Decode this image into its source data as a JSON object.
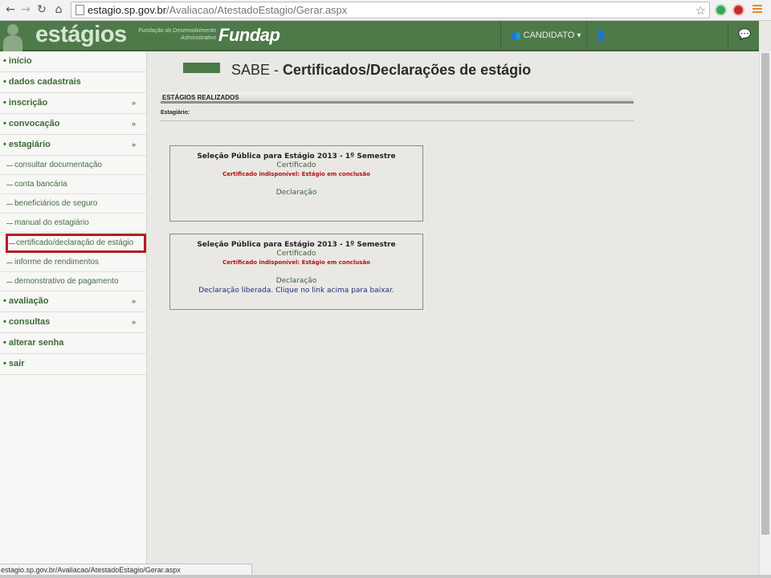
{
  "browser": {
    "url_host": "estagio.sp.gov.br",
    "url_path": "/Avaliacao/AtestadoEstagio/Gerar.aspx",
    "status_url": "estagio.sp.gov.br/Avaliacao/AtestadoEstagio/Gerar.aspx"
  },
  "header": {
    "logo": "estágios",
    "fund_small_1": "Fundação do Desenvolvimento",
    "fund_small_2": "Administrativo",
    "fund_brand": "Fundap",
    "candidate_label": "CANDIDATO",
    "accent": "#4e7a4a"
  },
  "sidebar": {
    "items": [
      {
        "label": "início"
      },
      {
        "label": "dados cadastrais"
      },
      {
        "label": "inscrição",
        "chevron": "»"
      },
      {
        "label": "convocação",
        "chevron": "»"
      },
      {
        "label": "estagiário",
        "chevron": "»"
      },
      {
        "label": "avaliação",
        "chevron": "»"
      },
      {
        "label": "consultas",
        "chevron": "»"
      },
      {
        "label": "alterar senha"
      },
      {
        "label": "sair"
      }
    ],
    "sub_items": [
      {
        "label": "consultar documentação"
      },
      {
        "label": "conta bancária"
      },
      {
        "label": "beneficiários de seguro"
      },
      {
        "label": "manual do estagiário"
      },
      {
        "label": "certificado/declaração de estágio"
      },
      {
        "label": "informe de rendimentos"
      },
      {
        "label": "demonstrativo de pagamento"
      }
    ]
  },
  "main": {
    "title_prefix": "SABE - ",
    "title": "Certificados/Declarações de estágio",
    "section_header": "ESTÁGIOS REALIZADOS",
    "estagiario_label": "Estagiário:",
    "cards": [
      {
        "title": "Seleção Pública para Estágio 2013 - 1º Semestre",
        "certificado": "Certificado",
        "warning": "Certificado indisponível: Estágio em conclusão",
        "declaracao": "Declaração",
        "note": ""
      },
      {
        "title": "Seleção Pública para Estágio 2013 - 1º Semestre",
        "certificado": "Certificado",
        "warning": "Certificado indisponível: Estágio em conclusão",
        "declaracao": "Declaração",
        "note": "Declaração liberada. Clique no link acima para baixar."
      }
    ]
  }
}
